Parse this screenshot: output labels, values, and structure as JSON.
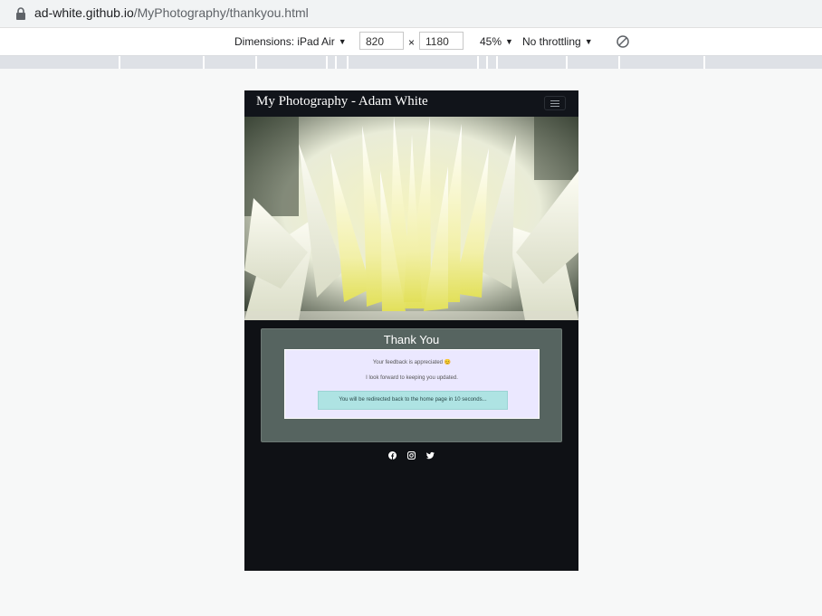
{
  "browser": {
    "url_host": "ad-white.github.io",
    "url_path": "/MyPhotography/thankyou.html"
  },
  "devtools": {
    "dimensions_label": "Dimensions: iPad Air",
    "width_value": "820",
    "times_symbol": "×",
    "height_value": "1180",
    "zoom": "45%",
    "throttling": "No throttling"
  },
  "site": {
    "brand": "My Photography - Adam White",
    "heading": "Thank You",
    "message_1": "Your feedback is appreciated 😊",
    "message_2": "I look forward to keeping you updated.",
    "redirect_notice": "You will be redirected back to the home page in 10 seconds...",
    "social_icons": [
      "facebook-icon",
      "instagram-icon",
      "twitter-icon"
    ]
  }
}
